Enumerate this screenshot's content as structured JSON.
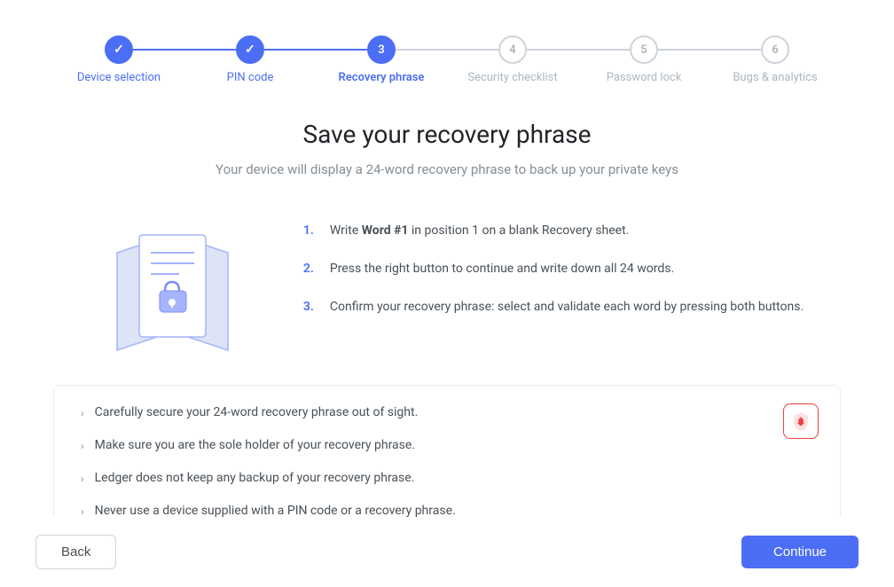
{
  "stepper": {
    "steps": [
      {
        "id": "device-selection",
        "label": "Device selection",
        "number": "✓",
        "state": "completed"
      },
      {
        "id": "pin-code",
        "label": "PIN code",
        "number": "✓",
        "state": "completed"
      },
      {
        "id": "recovery-phrase",
        "label": "Recovery phrase",
        "number": "3",
        "state": "active"
      },
      {
        "id": "security-checklist",
        "label": "Security checklist",
        "number": "4",
        "state": "inactive"
      },
      {
        "id": "password-lock",
        "label": "Password lock",
        "number": "5",
        "state": "inactive"
      },
      {
        "id": "bugs-analytics",
        "label": "Bugs & analytics",
        "number": "6",
        "state": "inactive"
      }
    ]
  },
  "main": {
    "title": "Save your recovery phrase",
    "subtitle": "Your device will display a 24-word recovery phrase to back up your private keys"
  },
  "instructions": {
    "steps": [
      {
        "number": "1.",
        "text": "Write ",
        "bold": "Word #1",
        "rest": " in position 1 on a blank Recovery sheet."
      },
      {
        "number": "2.",
        "text": "Press the right button to continue and write down all 24 words."
      },
      {
        "number": "3.",
        "text": "Confirm your recovery phrase: select and validate each word by pressing both buttons."
      }
    ]
  },
  "warnings": {
    "items": [
      "Carefully secure your 24-word recovery phrase out of sight.",
      "Make sure you are the sole holder of your recovery phrase.",
      "Ledger does not keep any backup of your recovery phrase.",
      "Never use a device supplied with a PIN code or a recovery phrase."
    ]
  },
  "buttons": {
    "back": "Back",
    "continue": "Continue"
  }
}
